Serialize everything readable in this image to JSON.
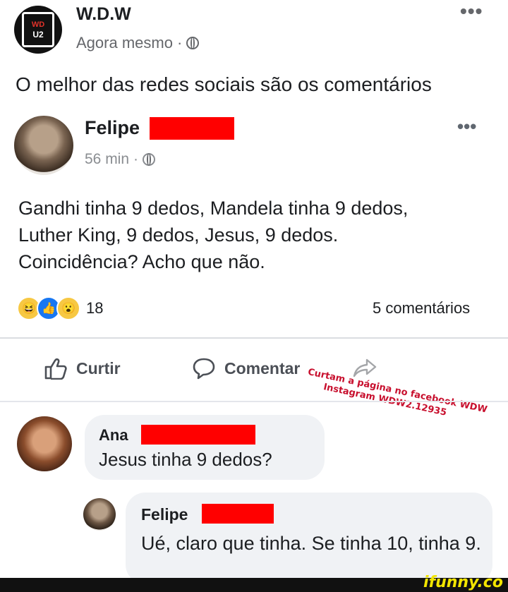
{
  "outer_post": {
    "avatar_text_top": "WD",
    "avatar_text_bottom": "U2",
    "author": "W.D.W",
    "time": "Agora mesmo",
    "separator": "·",
    "more": "•••",
    "caption": "O melhor das redes sociais são os comentários"
  },
  "inner_post": {
    "author": "Felipe",
    "time": "56 min",
    "separator": "·",
    "more": "•••",
    "lines": [
      "Gandhi tinha 9 dedos, Mandela tinha 9 dedos,",
      "Luther King, 9 dedos, Jesus, 9 dedos.",
      "Coincidência? Acho que não."
    ],
    "reaction_count": "18",
    "comments_count": "5 comentários",
    "actions": {
      "like": "Curtir",
      "comment": "Comentar"
    }
  },
  "watermark": {
    "line1": "Curtam a página no facebook WDW",
    "line2": "Instagram WDW2.12935"
  },
  "comments": [
    {
      "author": "Ana",
      "text": "Jesus tinha 9 dedos?"
    },
    {
      "author": "Felipe",
      "text": "Ué, claro que tinha. Se tinha 10, tinha 9."
    }
  ],
  "footer": {
    "brand": "ifunny.co"
  },
  "colors": {
    "redaction": "#ff0000",
    "like_blue": "#1877f2",
    "bubble_bg": "#f0f2f5",
    "watermark": "#c8102e",
    "ifunny_yellow": "#f2e500"
  }
}
